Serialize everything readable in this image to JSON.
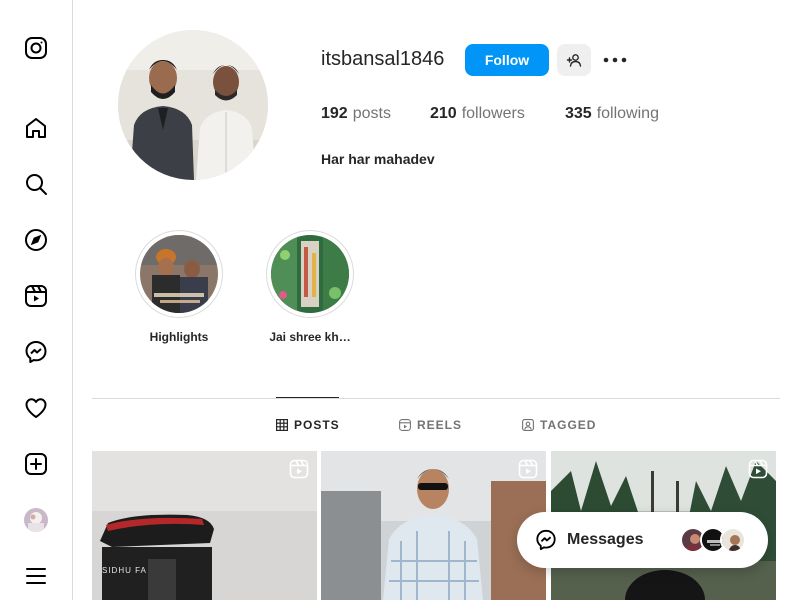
{
  "sidebar": {
    "items": [
      {
        "icon": "instagram-logo-icon"
      },
      {
        "icon": "home-icon"
      },
      {
        "icon": "search-icon"
      },
      {
        "icon": "explore-icon"
      },
      {
        "icon": "reels-icon"
      },
      {
        "icon": "messenger-icon"
      },
      {
        "icon": "heart-icon"
      },
      {
        "icon": "create-icon"
      },
      {
        "icon": "profile-avatar"
      },
      {
        "icon": "menu-icon"
      }
    ]
  },
  "profile": {
    "username": "itsbansal1846",
    "follow_label": "Follow",
    "posts_count": "192",
    "posts_label": "posts",
    "followers_count": "210",
    "followers_label": "followers",
    "following_count": "335",
    "following_label": "following",
    "bio": "Har har mahadev"
  },
  "highlights": [
    {
      "label": "Highlights"
    },
    {
      "label": "Jai shree kh…"
    }
  ],
  "tabs": [
    {
      "label": "POSTS",
      "icon": "grid-icon",
      "active": true
    },
    {
      "label": "REELS",
      "icon": "reels-icon",
      "active": false
    },
    {
      "label": "TAGGED",
      "icon": "tagged-icon",
      "active": false
    }
  ],
  "posts": [
    {
      "type": "reel",
      "caption": "SIDHU FA"
    },
    {
      "type": "reel"
    },
    {
      "type": "reel"
    }
  ],
  "messages": {
    "label": "Messages"
  },
  "colors": {
    "accent": "#0095f6",
    "text": "#262626",
    "muted": "#737373",
    "border": "#dbdbdb"
  }
}
